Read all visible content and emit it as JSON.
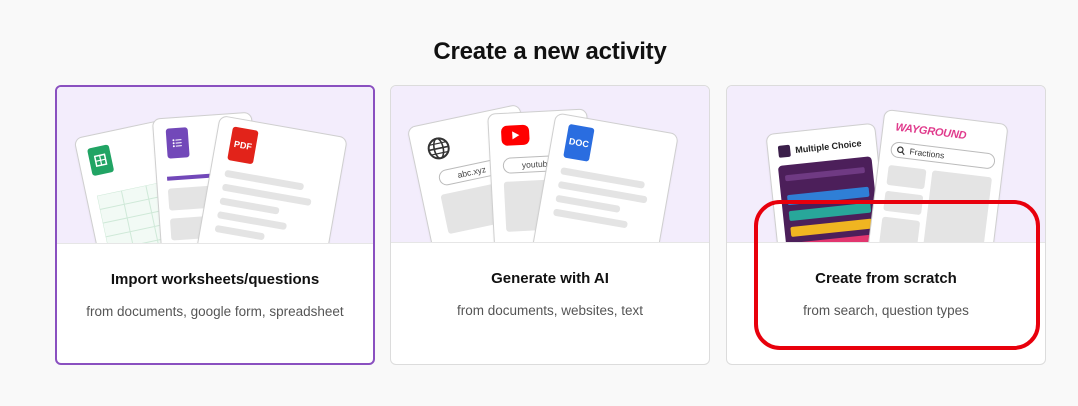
{
  "page": {
    "title": "Create a new activity"
  },
  "cards": [
    {
      "title": "Import worksheets/questions",
      "subtitle": "from documents, google form, spreadsheet",
      "pdf_label": "PDF"
    },
    {
      "title": "Generate with AI",
      "subtitle": "from documents, websites, text",
      "url_label": "abc.xyz",
      "video_label": "youtub",
      "doc_label": "DOC"
    },
    {
      "title": "Create from scratch",
      "subtitle": "from search, question types",
      "mc_label": "Multiple Choice",
      "brand_label": "WAYGROUND",
      "search_label": "Fractions"
    }
  ],
  "colors": {
    "accent_purple": "#8a50c0",
    "highlight_red": "#e8000c",
    "illus_bg": "#f3edfc"
  }
}
